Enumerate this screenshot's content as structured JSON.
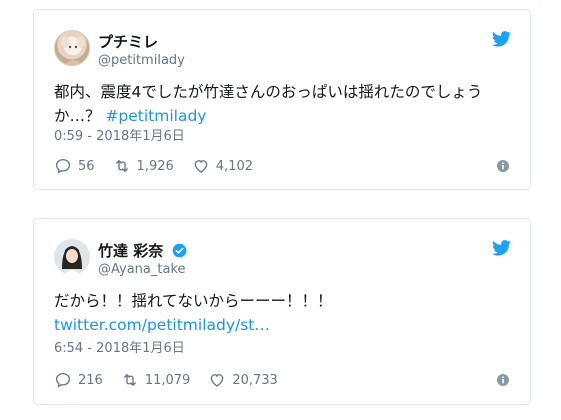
{
  "tweets": [
    {
      "display_name": "プチミレ",
      "handle": "@petitmilady",
      "verified": false,
      "text_lines": [
        {
          "plain": "都内、震度4でしたが竹達さんのおっぱいは揺れたのでしょう",
          "link": ""
        },
        {
          "plain": "か…？ ",
          "link": "#petitmilady"
        }
      ],
      "timestamp": "0:59 - 2018年1月6日",
      "reply_count": "56",
      "retweet_count": "1,926",
      "like_count": "4,102"
    },
    {
      "display_name": "竹達 彩奈",
      "handle": "@Ayana_take",
      "verified": true,
      "text_lines": [
        {
          "plain": "だから！！揺れてないからーーー！！！",
          "link": ""
        },
        {
          "plain": "",
          "link": "twitter.com/petitmilady/st…"
        }
      ],
      "timestamp": "6:54 - 2018年1月6日",
      "reply_count": "216",
      "retweet_count": "11,079",
      "like_count": "20,733"
    }
  ],
  "colors": {
    "link": "#1b95e0",
    "muted": "#657786",
    "text": "#14171a",
    "border": "#e1e8ed",
    "twitter_blue": "#1da1f2"
  },
  "icons": [
    "twitter-bird-icon",
    "verified-badge-icon",
    "reply-icon",
    "retweet-icon",
    "like-icon",
    "info-icon"
  ]
}
